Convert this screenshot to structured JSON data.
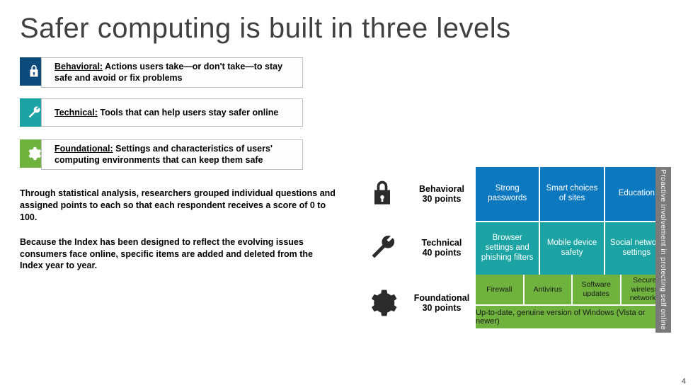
{
  "title": "Safer computing is built in three levels",
  "legend": {
    "behavioral": {
      "label": "Behavioral:",
      "desc": "Actions users take—or don't take—to stay safe and avoid or fix problems"
    },
    "technical": {
      "label": "Technical:",
      "desc": "Tools that can help users stay safer online"
    },
    "foundational": {
      "label": "Foundational:",
      "desc": "Settings and characteristics of users' computing environments that can keep them safe"
    }
  },
  "para1": "Through statistical analysis, researchers grouped individual questions and assigned points to each so that each respondent receives a score of 0 to 100.",
  "para2": "Because the Index has been designed to reflect the evolving issues consumers face online, specific items are added and deleted from the Index year to year.",
  "grid": {
    "rows": [
      {
        "name": "Behavioral",
        "points": "30 points",
        "cells": [
          "Strong passwords",
          "Smart choices of sites",
          "Education"
        ]
      },
      {
        "name": "Technical",
        "points": "40 points",
        "cells": [
          "Browser settings and phishing filters",
          "Mobile device safety",
          "Social network settings"
        ]
      },
      {
        "name": "Foundational",
        "points": "30 points",
        "top": [
          "Firewall",
          "Antivirus",
          "Software updates",
          "Secure wireless networks"
        ],
        "bottom": "Up-to-date, genuine version of Windows (Vista or newer)"
      }
    ]
  },
  "sidebar": "Proactive involvement in protecting self online",
  "page": "4"
}
